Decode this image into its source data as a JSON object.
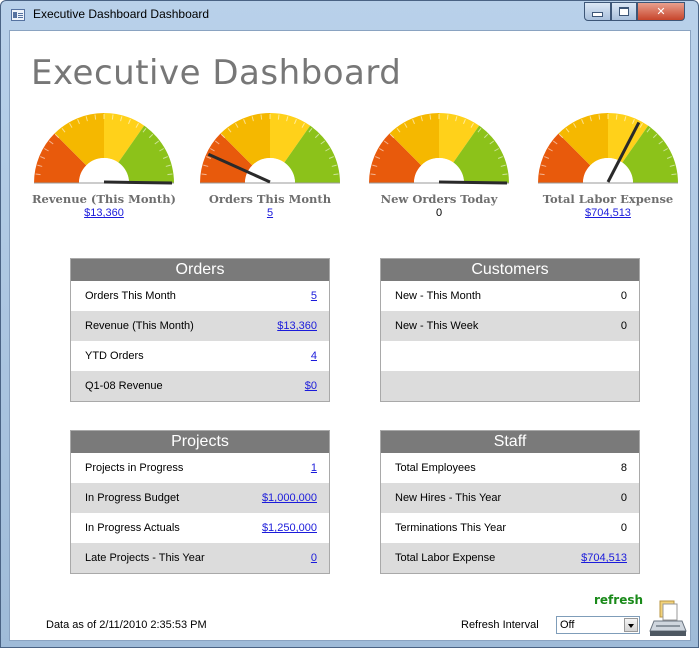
{
  "window": {
    "title": "Executive Dashboard Dashboard"
  },
  "page": {
    "title": "Executive Dashboard"
  },
  "gauges": [
    {
      "label": "Revenue (This Month)",
      "value": "$13,360",
      "needle_deg": 0,
      "link": true
    },
    {
      "label": "Orders This Month",
      "value": "5",
      "needle_deg": 155,
      "link": true
    },
    {
      "label": "New Orders Today",
      "value": "0",
      "needle_deg": 0,
      "link": false
    },
    {
      "label": "Total Labor Expense",
      "value": "$704,513",
      "needle_deg": 63,
      "link": true
    }
  ],
  "gauge_colors": [
    "#e85a0c",
    "#f5b800",
    "#ffd11a",
    "#8cc21a"
  ],
  "orders": {
    "title": "Orders",
    "rows": [
      {
        "label": "Orders This Month",
        "value": "5"
      },
      {
        "label": "Revenue (This Month)",
        "value": "$13,360"
      },
      {
        "label": "YTD Orders",
        "value": "4"
      },
      {
        "label": "Q1-08 Revenue",
        "value": "$0"
      }
    ]
  },
  "customers": {
    "title": "Customers",
    "rows": [
      {
        "label": "New - This Month",
        "value": "0"
      },
      {
        "label": "New - This Week",
        "value": "0"
      }
    ]
  },
  "projects": {
    "title": "Projects",
    "rows": [
      {
        "label": "Projects in Progress",
        "value": "1"
      },
      {
        "label": "In Progress Budget",
        "value": "$1,000,000"
      },
      {
        "label": "In Progress Actuals",
        "value": "$1,250,000"
      },
      {
        "label": "Late Projects - This Year",
        "value": "0"
      }
    ]
  },
  "staff": {
    "title": "Staff",
    "rows": [
      {
        "label": "Total Employees",
        "value": "8"
      },
      {
        "label": "New Hires - This Year",
        "value": "0"
      },
      {
        "label": "Terminations This Year",
        "value": "0"
      },
      {
        "label": "Total Labor Expense",
        "value": "$704,513"
      }
    ]
  },
  "footer": {
    "data_as_of": "Data as of 2/11/2010 2:35:53 PM",
    "refresh_label": "refresh",
    "interval_label": "Refresh Interval",
    "interval_value": "Off"
  }
}
